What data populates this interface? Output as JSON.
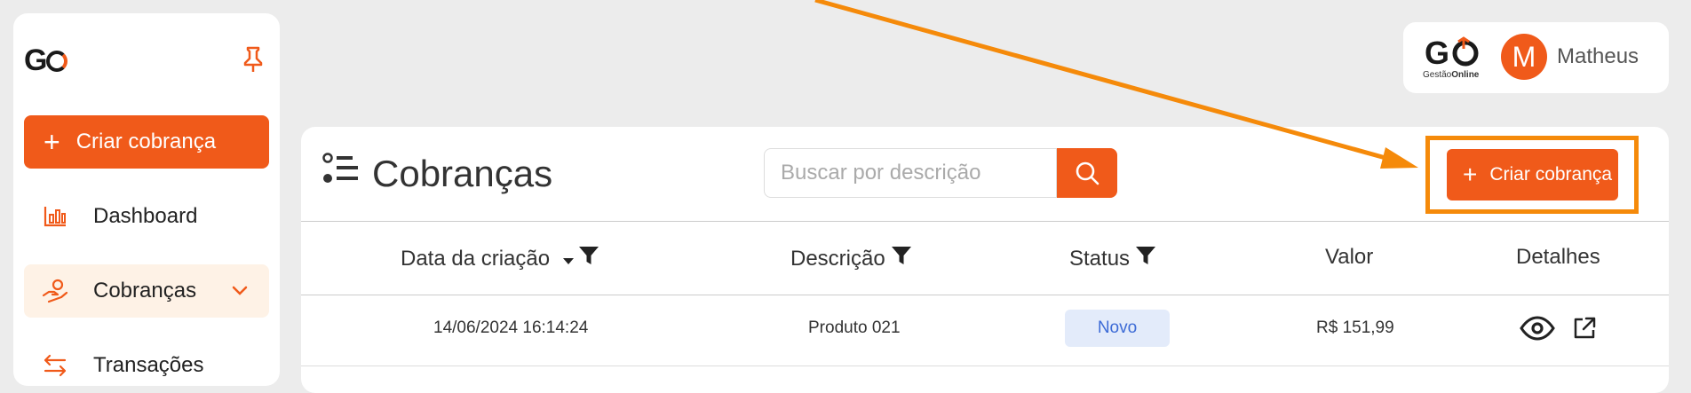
{
  "brand": {
    "logo_text": "G",
    "card_logo_top": "G",
    "card_logo_sub_a": "Gestão",
    "card_logo_sub_b": "Online"
  },
  "sidebar": {
    "create_label": "Criar cobrança",
    "items": [
      {
        "label": "Dashboard",
        "icon": "bar-chart-icon"
      },
      {
        "label": "Cobranças",
        "icon": "hand-coin-icon",
        "active": true
      },
      {
        "label": "Transações",
        "icon": "swap-arrows-icon"
      }
    ]
  },
  "user": {
    "initial": "M",
    "name": "Matheus"
  },
  "panel": {
    "title": "Cobranças",
    "search_placeholder": "Buscar por descrição",
    "create_label": "Criar cobrança"
  },
  "table": {
    "columns": [
      "Data da criação",
      "Descrição",
      "Status",
      "Valor",
      "Detalhes"
    ],
    "rows": [
      {
        "date": "14/06/2024 16:14:24",
        "description": "Produto 021",
        "status": "Novo",
        "value": "R$ 151,99"
      }
    ]
  },
  "colors": {
    "accent": "#f05a1a",
    "highlight": "#f58a0a",
    "badge_bg": "#e3ebfa",
    "badge_text": "#3d6bd6"
  }
}
